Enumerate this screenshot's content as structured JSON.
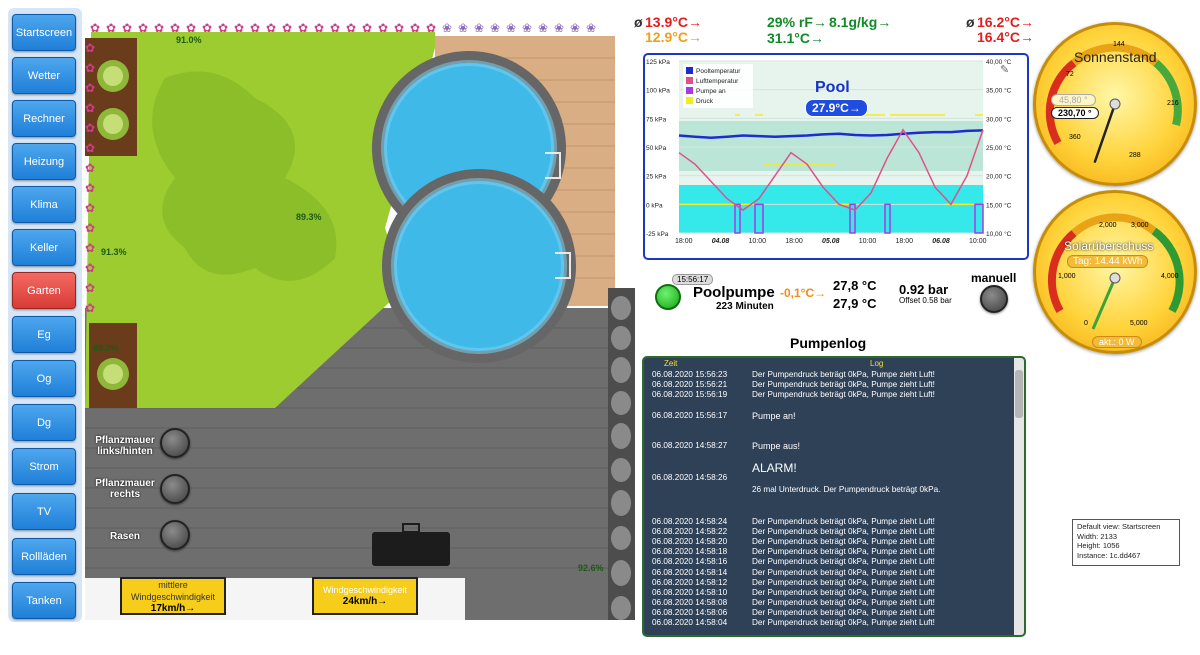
{
  "nav": {
    "items": [
      {
        "label": "Startscreen",
        "active": false
      },
      {
        "label": "Wetter",
        "active": false
      },
      {
        "label": "Rechner",
        "active": false
      },
      {
        "label": "Heizung",
        "active": false
      },
      {
        "label": "Klima",
        "active": false
      },
      {
        "label": "Keller",
        "active": false
      },
      {
        "label": "Garten",
        "active": true
      },
      {
        "label": "Eg",
        "active": false
      },
      {
        "label": "Og",
        "active": false
      },
      {
        "label": "Dg",
        "active": false
      },
      {
        "label": "Strom",
        "active": false
      },
      {
        "label": "TV",
        "active": false
      },
      {
        "label": "Rollläden",
        "active": false
      },
      {
        "label": "Tanken",
        "active": false
      }
    ]
  },
  "garden": {
    "pct_top": "91.0%",
    "pct_lawn": "89.3%",
    "pct_left": "91.3%",
    "pct_bed": "89.3%",
    "pct_corner": "92.6%",
    "switches": [
      {
        "label": "Pflanzmauer links/hinten"
      },
      {
        "label": "Pflanzmauer rechts"
      },
      {
        "label": "Rasen"
      }
    ],
    "wind1": {
      "title": "mittlere Windgeschwindigkeit",
      "value": "17km/h→"
    },
    "wind2": {
      "title": "Windgeschwindigkeit",
      "value": "24km/h→"
    }
  },
  "temps": {
    "avg_symbol": "ø",
    "left_top": "13.9°C→",
    "left_bottom": "12.9°C→",
    "hum": "29% rF→",
    "abs": "8.1g/kg→",
    "mid_bottom": "31.1°C→",
    "right_top": "16.2°C→",
    "right_bottom": "16.4°C→"
  },
  "chart_data": {
    "type": "line",
    "title": "Pool",
    "current": "27.9°C→",
    "legend": [
      "Pooltemperatur",
      "Lufttemperatur",
      "Pumpe an",
      "Druck"
    ],
    "colors": [
      "#1f2bd1",
      "#e0508a",
      "#a83ae0",
      "#f3ec20"
    ],
    "y_left_ticks": [
      "125 kPa",
      "100 kPa",
      "75 kPa",
      "50 kPa",
      "25 kPa",
      "0 kPa",
      "-25 kPa"
    ],
    "y_right_ticks": [
      "40,00 °C",
      "35,00 °C",
      "30,00 °C",
      "25,00 °C",
      "20,00 °C",
      "15,00 °C",
      "10,00 °C"
    ],
    "x_ticks": [
      "18:00",
      "04.08",
      "10:00",
      "18:00",
      "05.08",
      "10:00",
      "18:00",
      "06.08",
      "10:00"
    ],
    "x_bold": [
      false,
      true,
      false,
      false,
      true,
      false,
      false,
      true,
      false
    ],
    "pool_temp": [
      27,
      26.8,
      26.6,
      26.8,
      27,
      26.9,
      26.8,
      26.9,
      27,
      27.2,
      27.3,
      27.1,
      27,
      27.1,
      27.3,
      27.5,
      27.6,
      27.6,
      27.8,
      27.9
    ],
    "air_temp": [
      24,
      22,
      19,
      16,
      14,
      16,
      20,
      24,
      22,
      18,
      15,
      14,
      17,
      23,
      28,
      24,
      18,
      15,
      20,
      28
    ]
  },
  "pump": {
    "time": "15:56:17",
    "name": "Poolpumpe",
    "minutes": "223 Minuten",
    "delta": "-0,1°C→",
    "t1": "27,8 °C",
    "t2": "27,9 °C",
    "pressure": "0.92 bar",
    "offset": "Offset 0.58 bar",
    "mode": "manuell"
  },
  "log": {
    "title": "Pumpenlog",
    "col_time": "Zeit",
    "col_log": "Log",
    "rows": [
      {
        "t": "06.08.2020 15:56:23",
        "m": "Der Pumpendruck beträgt 0kPa, Pumpe zieht Luft!"
      },
      {
        "t": "06.08.2020 15:56:21",
        "m": "Der Pumpendruck beträgt 0kPa, Pumpe zieht Luft!"
      },
      {
        "t": "06.08.2020 15:56:19",
        "m": "Der Pumpendruck beträgt 0kPa, Pumpe zieht Luft!"
      }
    ],
    "pumpe_an_t": "06.08.2020 15:56:17",
    "pumpe_an_m": "Pumpe an!",
    "pumpe_aus_t": "06.08.2020 14:58:27",
    "pumpe_aus_m": "Pumpe aus!",
    "alarm_t": "06.08.2020 14:58:26",
    "alarm_title": "ALARM!",
    "alarm_msg": "26 mal Unterdruck. Der Pumpendruck beträgt 0kPa.",
    "rows2": [
      {
        "t": "06.08.2020 14:58:24",
        "m": "Der Pumpendruck beträgt 0kPa, Pumpe zieht Luft!"
      },
      {
        "t": "06.08.2020 14:58:22",
        "m": "Der Pumpendruck beträgt 0kPa, Pumpe zieht Luft!"
      },
      {
        "t": "06.08.2020 14:58:20",
        "m": "Der Pumpendruck beträgt 0kPa, Pumpe zieht Luft!"
      },
      {
        "t": "06.08.2020 14:58:18",
        "m": "Der Pumpendruck beträgt 0kPa, Pumpe zieht Luft!"
      },
      {
        "t": "06.08.2020 14:58:16",
        "m": "Der Pumpendruck beträgt 0kPa, Pumpe zieht Luft!"
      },
      {
        "t": "06.08.2020 14:58:14",
        "m": "Der Pumpendruck beträgt 0kPa, Pumpe zieht Luft!"
      },
      {
        "t": "06.08.2020 14:58:12",
        "m": "Der Pumpendruck beträgt 0kPa, Pumpe zieht Luft!"
      },
      {
        "t": "06.08.2020 14:58:10",
        "m": "Der Pumpendruck beträgt 0kPa, Pumpe zieht Luft!"
      },
      {
        "t": "06.08.2020 14:58:08",
        "m": "Der Pumpendruck beträgt 0kPa, Pumpe zieht Luft!"
      },
      {
        "t": "06.08.2020 14:58:06",
        "m": "Der Pumpendruck beträgt 0kPa, Pumpe zieht Luft!"
      },
      {
        "t": "06.08.2020 14:58:04",
        "m": "Der Pumpendruck beträgt 0kPa, Pumpe zieht Luft!"
      }
    ]
  },
  "sun": {
    "title": "Sonnenstand",
    "ticks": [
      "144",
      "72",
      "216",
      "360",
      "288"
    ],
    "elev": "45,80 °",
    "azimuth": "230,70 °",
    "needle_deg": 230.7
  },
  "solar": {
    "title": "Solarüberschuss",
    "day": "Tag: 14.44 kWh",
    "ticks": [
      "2,000",
      "3,000",
      "1,000",
      "4,000",
      "0",
      "5,000"
    ],
    "current": "akt.: 0 W",
    "needle_value": 0
  },
  "info": {
    "lines": [
      "Default view: Startscreen",
      "Width: 2133",
      "Height: 1056",
      "Instance: 1c.dd467"
    ]
  }
}
